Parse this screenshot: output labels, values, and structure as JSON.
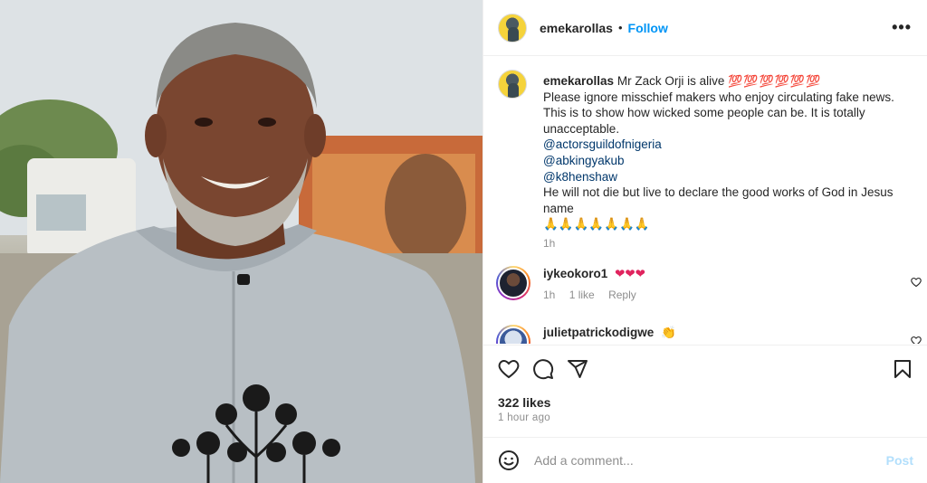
{
  "header": {
    "username": "emekarollas",
    "separator": "•",
    "follow_label": "Follow",
    "more_label": "•••"
  },
  "caption": {
    "username": "emekarollas",
    "first_line": "Mr Zack Orji is alive",
    "first_line_emoji": "💯💯💯💯💯💯",
    "lines": [
      "Please ignore misschief makers who enjoy circulating fake news.",
      "This is to show how wicked some people can be. It is totally unacceptable."
    ],
    "mentions": [
      "@actorsguildofnigeria",
      "@abkingyakub",
      "@k8henshaw"
    ],
    "closing": "He will not die but live to declare the good works of God in Jesus name",
    "prayer_emoji": "🙏🙏🙏🙏🙏🙏🙏",
    "time": "1h"
  },
  "comments": [
    {
      "username": "iykeokoro1",
      "text": "❤❤❤",
      "time": "1h",
      "likes": "1 like",
      "reply_label": "Reply"
    },
    {
      "username": "julietpatrickodigwe",
      "text": "👏"
    }
  ],
  "actions": {
    "likes": "322 likes",
    "posted": "1 hour ago"
  },
  "add_comment": {
    "placeholder": "Add a comment...",
    "post_label": "Post"
  },
  "colors": {
    "accent": "#0095f6",
    "mention": "#00376b",
    "muted": "#8e8e8e",
    "heart": "#e0245e"
  },
  "icons": [
    "smile-icon",
    "heart-icon",
    "comment-icon",
    "share-icon",
    "bookmark-icon",
    "more-icon"
  ]
}
